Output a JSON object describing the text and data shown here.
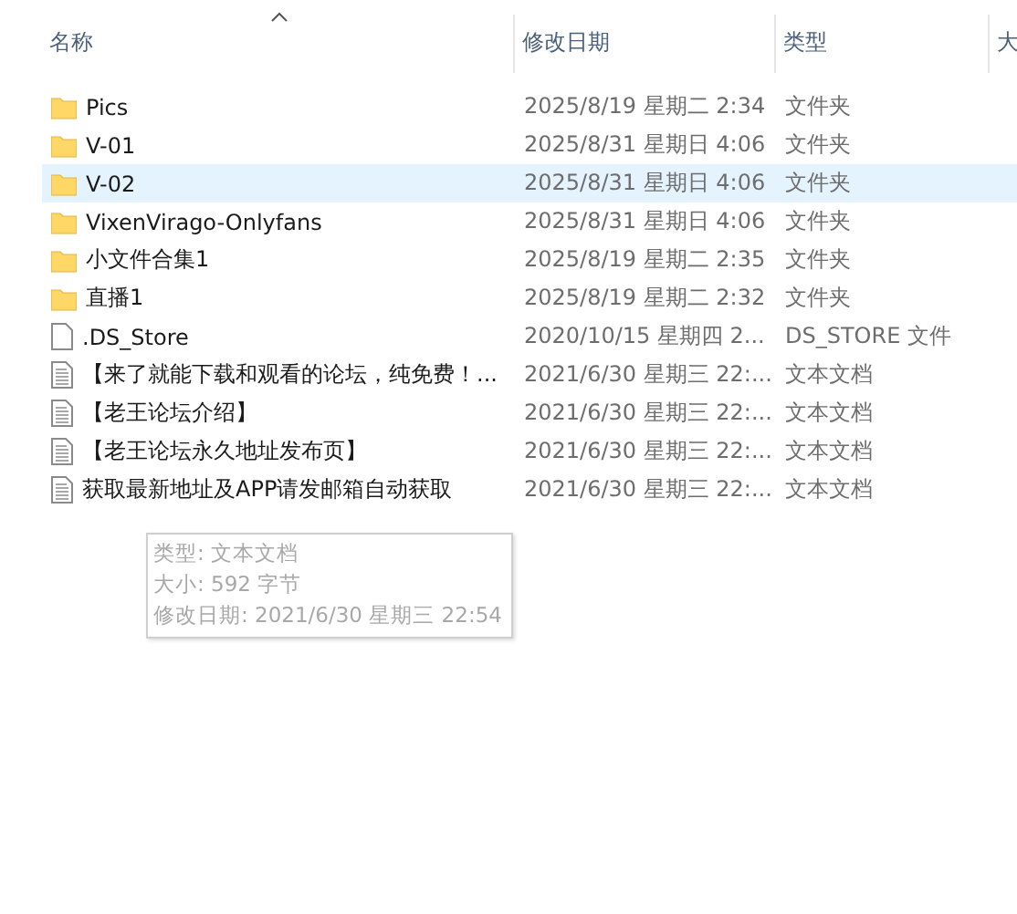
{
  "columns": [
    {
      "label": "名称",
      "sorted": true
    },
    {
      "label": "修改日期",
      "sorted": false
    },
    {
      "label": "类型",
      "sorted": false
    },
    {
      "label": "大",
      "sorted": false
    }
  ],
  "rows": [
    {
      "kind": "folder",
      "name": "Pics",
      "date": "2025/8/19 星期二 2:34",
      "type": "文件夹",
      "selected": false
    },
    {
      "kind": "folder",
      "name": "V-01",
      "date": "2025/8/31 星期日 4:06",
      "type": "文件夹",
      "selected": false
    },
    {
      "kind": "folder",
      "name": "V-02",
      "date": "2025/8/31 星期日 4:06",
      "type": "文件夹",
      "selected": true
    },
    {
      "kind": "folder",
      "name": "VixenVirago-Onlyfans",
      "date": "2025/8/31 星期日 4:06",
      "type": "文件夹",
      "selected": false
    },
    {
      "kind": "folder",
      "name": "小文件合集1",
      "date": "2025/8/19 星期二 2:35",
      "type": "文件夹",
      "selected": false
    },
    {
      "kind": "folder",
      "name": "直播1",
      "date": "2025/8/19 星期二 2:32",
      "type": "文件夹",
      "selected": false
    },
    {
      "kind": "file",
      "name": ".DS_Store",
      "date": "2020/10/15 星期四 2...",
      "type": "DS_STORE 文件",
      "selected": false
    },
    {
      "kind": "text",
      "name": "【来了就能下载和观看的论坛，纯免费！...",
      "date": "2021/6/30 星期三 22:...",
      "type": "文本文档",
      "selected": false
    },
    {
      "kind": "text",
      "name": "【老王论坛介绍】",
      "date": "2021/6/30 星期三 22:...",
      "type": "文本文档",
      "selected": false
    },
    {
      "kind": "text",
      "name": "【老王论坛永久地址发布页】",
      "date": "2021/6/30 星期三 22:...",
      "type": "文本文档",
      "selected": false
    },
    {
      "kind": "text",
      "name": "获取最新地址及APP请发邮箱自动获取",
      "date": "2021/6/30 星期三 22:...",
      "type": "文本文档",
      "selected": false
    }
  ],
  "tooltip": {
    "lines": [
      "类型: 文本文档",
      "大小: 592 字节",
      "修改日期: 2021/6/30 星期三 22:54"
    ]
  }
}
